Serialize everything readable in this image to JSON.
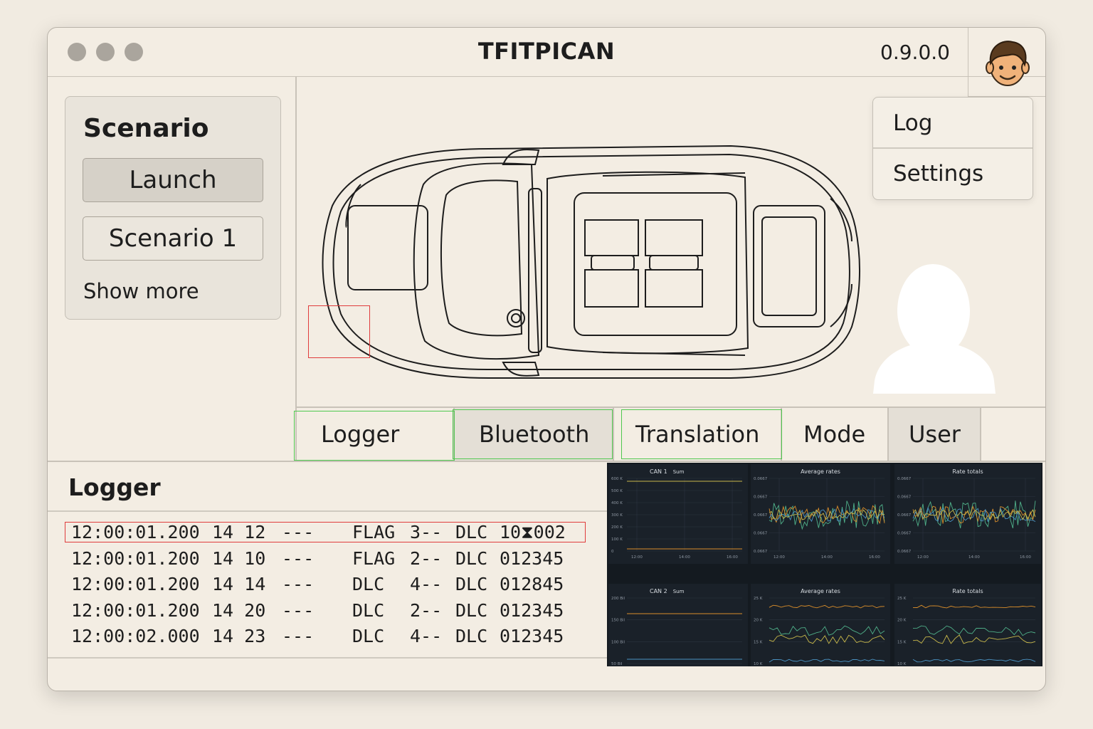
{
  "window": {
    "title": "TFITPICAN",
    "version": "0.9.0.0",
    "avatar_icon": "user-face-avatar"
  },
  "scenario": {
    "title": "Scenario",
    "buttons": [
      "Launch",
      "Scenario 1"
    ],
    "show_more": "Show more"
  },
  "dropdown_menu": {
    "items": [
      "Log",
      "Settings"
    ]
  },
  "tabs": [
    {
      "label": "Logger",
      "selected": false
    },
    {
      "label": "Bluetooth",
      "selected": true
    },
    {
      "label": "Translation",
      "selected": false
    },
    {
      "label": "Mode",
      "selected": false
    },
    {
      "label": "User",
      "selected": true
    }
  ],
  "logger": {
    "title": "Logger",
    "rows": [
      {
        "time": "12:00:01.200",
        "id": "14 12",
        "dash": "---",
        "type": "FLAG",
        "len": "3--",
        "dlc": "DLC",
        "data": "10⧗002"
      },
      {
        "time": "12:00:01.200",
        "id": "14 10",
        "dash": "---",
        "type": "FLAG",
        "len": "2--",
        "dlc": "DLC",
        "data": "012345"
      },
      {
        "time": "12:00:01.200",
        "id": "14 14",
        "dash": "---",
        "type": "DLC",
        "len": "4--",
        "dlc": "DLC",
        "data": "012845"
      },
      {
        "time": "12:00:01.200",
        "id": "14 20",
        "dash": "---",
        "type": "DLC",
        "len": "2--",
        "dlc": "DLC",
        "data": "012345"
      },
      {
        "time": "12:00:02.000",
        "id": "14 23",
        "dash": "---",
        "type": "DLC",
        "len": "4--",
        "dlc": "DLC",
        "data": "012345"
      }
    ]
  },
  "dashboard": {
    "panels": [
      {
        "title": "CAN 1",
        "sub": "Sum",
        "yticks": [
          "600 K",
          "500 K",
          "400 K",
          "300 K",
          "200 K",
          "100 K",
          "0"
        ],
        "xticks": [
          "12:00",
          "14:00",
          "16:00"
        ]
      },
      {
        "title": "Average rates",
        "yticks": [
          "0.0667",
          "0.0667",
          "0.0667",
          "0.0667",
          "0.0667"
        ],
        "xticks": [
          "12:00",
          "14:00",
          "16:00"
        ]
      },
      {
        "title": "Rate totals",
        "yticks": [
          "0.0667",
          "0.0667",
          "0.0667",
          "0.0667",
          "0.0667"
        ],
        "xticks": [
          "12:00",
          "14:00",
          "16:00"
        ]
      },
      {
        "title": "CAN 2",
        "sub": "Sum",
        "yticks": [
          "200 Bil",
          "150 Bil",
          "100 Bil",
          "50 Bil"
        ]
      },
      {
        "title": "Average rates",
        "yticks": [
          "25 K",
          "20 K",
          "15 K",
          "10 K"
        ]
      },
      {
        "title": "Rate totals",
        "yticks": [
          "25 K",
          "20 K",
          "15 K",
          "10 K"
        ]
      }
    ],
    "colors": {
      "green": "#4fb089",
      "orange": "#d98d2a",
      "yellow": "#c8b84a",
      "blue": "#4c94c4"
    }
  }
}
